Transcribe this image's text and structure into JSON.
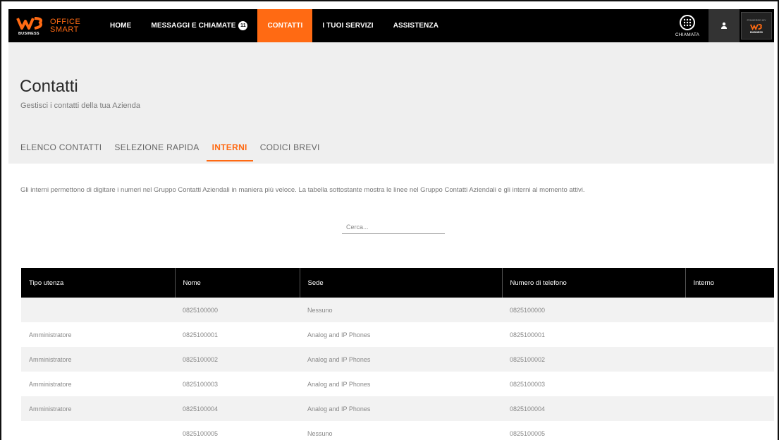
{
  "brand": {
    "business_label": "BUSINESS",
    "line1": "OFFICE",
    "line2": "SMART",
    "accent": "#ff6a13"
  },
  "nav": {
    "items": [
      {
        "label": "HOME"
      },
      {
        "label": "MESSAGGI E CHIAMATE",
        "badge": "11"
      },
      {
        "label": "CONTATTI",
        "active": true
      },
      {
        "label": "I TUOI SERVIZI"
      },
      {
        "label": "ASSISTENZA"
      }
    ],
    "call_label": "CHIAMATA",
    "powered_by": "POWERED BY",
    "powered_brand": "BUSINESS"
  },
  "page": {
    "title": "Contatti",
    "subtitle": "Gestisci i contatti della tua Azienda",
    "tabs": [
      {
        "label": "ELENCO CONTATTI"
      },
      {
        "label": "SELEZIONE RAPIDA"
      },
      {
        "label": "INTERNI",
        "active": true
      },
      {
        "label": "CODICI BREVI"
      }
    ],
    "intro": "Gli interni permettono di digitare i numeri nel Gruppo Contatti Aziendali in maniera più veloce. La tabella sottostante mostra le linee nel Gruppo Contatti Aziendali e gli interni al momento attivi.",
    "search_placeholder": "Cerca..."
  },
  "table": {
    "headers": [
      "Tipo utenza",
      "Nome",
      "Sede",
      "Numero di telefono",
      "Interno"
    ],
    "rows": [
      [
        "",
        "0825100000",
        "Nessuno",
        "0825100000",
        ""
      ],
      [
        "Amministratore",
        "0825100001",
        "Analog and IP Phones",
        "0825100001",
        ""
      ],
      [
        "Amministratore",
        "0825100002",
        "Analog and IP Phones",
        "0825100002",
        ""
      ],
      [
        "Amministratore",
        "0825100003",
        "Analog and IP Phones",
        "0825100003",
        ""
      ],
      [
        "Amministratore",
        "0825100004",
        "Analog and IP Phones",
        "0825100004",
        ""
      ],
      [
        "",
        "0825100005",
        "Nessuno",
        "0825100005",
        ""
      ]
    ]
  }
}
